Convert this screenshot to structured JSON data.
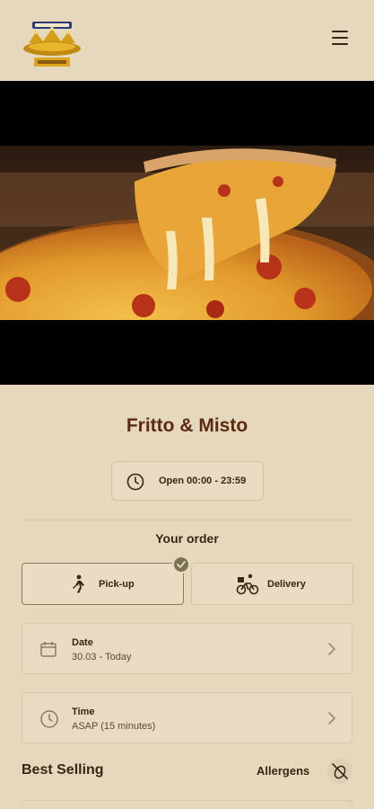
{
  "header": {
    "logo_icon": "crown-logo",
    "menu_icon": "hamburger-menu-icon"
  },
  "hero": {
    "image_icon": "pizza-cheese-pull-photo"
  },
  "restaurant": {
    "name": "Fritto & Misto",
    "hours": "Open 00:00 - 23:59"
  },
  "order": {
    "title": "Your order",
    "modes": [
      {
        "label": "Pick-up",
        "icon": "walking-person-icon",
        "selected": true
      },
      {
        "label": "Delivery",
        "icon": "bicycle-courier-icon",
        "selected": false
      }
    ],
    "date": {
      "label": "Date",
      "value": "30.03 - Today",
      "icon": "calendar-icon"
    },
    "time": {
      "label": "Time",
      "value": "ASAP (15 minutes)",
      "icon": "clock-icon"
    }
  },
  "menu_section": {
    "title": "Best Selling",
    "allergens_label": "Allergens",
    "allergens_icon": "no-allergen-icon"
  },
  "colors": {
    "background": "#e6d8bd",
    "accent_text": "#5a2a12",
    "badge": "#7a7256"
  }
}
